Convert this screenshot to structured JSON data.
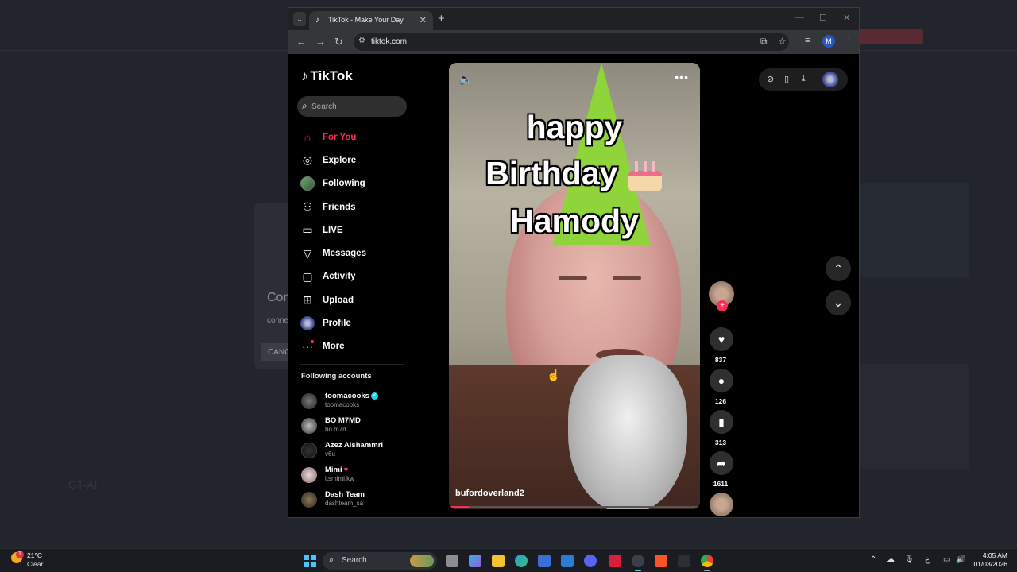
{
  "browser": {
    "tab_title": "TikTok - Make Your Day",
    "url": "tiktok.com",
    "profile_initial": "M"
  },
  "tiktok": {
    "logo": "TikTok",
    "search_placeholder": "Search",
    "menu": [
      {
        "label": "For You",
        "icon": "home-icon",
        "active": true
      },
      {
        "label": "Explore",
        "icon": "compass-icon"
      },
      {
        "label": "Following",
        "icon": "following-avatar-icon"
      },
      {
        "label": "Friends",
        "icon": "friends-icon"
      },
      {
        "label": "LIVE",
        "icon": "live-tv-icon"
      },
      {
        "label": "Messages",
        "icon": "send-icon"
      },
      {
        "label": "Activity",
        "icon": "activity-icon"
      },
      {
        "label": "Upload",
        "icon": "upload-icon"
      },
      {
        "label": "Profile",
        "icon": "profile-avatar-icon"
      },
      {
        "label": "More",
        "icon": "more-dots-icon"
      }
    ],
    "following_title": "Following accounts",
    "accounts": [
      {
        "name": "toomacooks",
        "handle": "toomacooks",
        "verified": true
      },
      {
        "name": "BO M7MD",
        "handle": "bo.m7d"
      },
      {
        "name": "Azez Alshammri",
        "handle": "v6u"
      },
      {
        "name": "Mimi",
        "handle": "itsmimi.kw"
      },
      {
        "name": "Dash Team",
        "handle": "dashteam_sa"
      }
    ],
    "video": {
      "caption_line1": "happy",
      "caption_line2": "Birthday",
      "caption_line3": "Hamody",
      "username": "bufordoverland2",
      "progress": 0.08
    },
    "actions": {
      "likes": "837",
      "comments": "126",
      "saves": "313",
      "shares": "1611"
    }
  },
  "background": {
    "dialog_title": "Con",
    "dialog_text": "conne",
    "dialog_button": "CANC",
    "bottom_label": "GT-AI"
  },
  "taskbar": {
    "temperature": "21°C",
    "condition": "Clear",
    "weather_badge": "1",
    "search_label": "Search",
    "time": "4:05 AM",
    "date": "01/03/2026"
  },
  "colors": {
    "accent": "#fe2c55",
    "verified": "#20d5ec"
  }
}
